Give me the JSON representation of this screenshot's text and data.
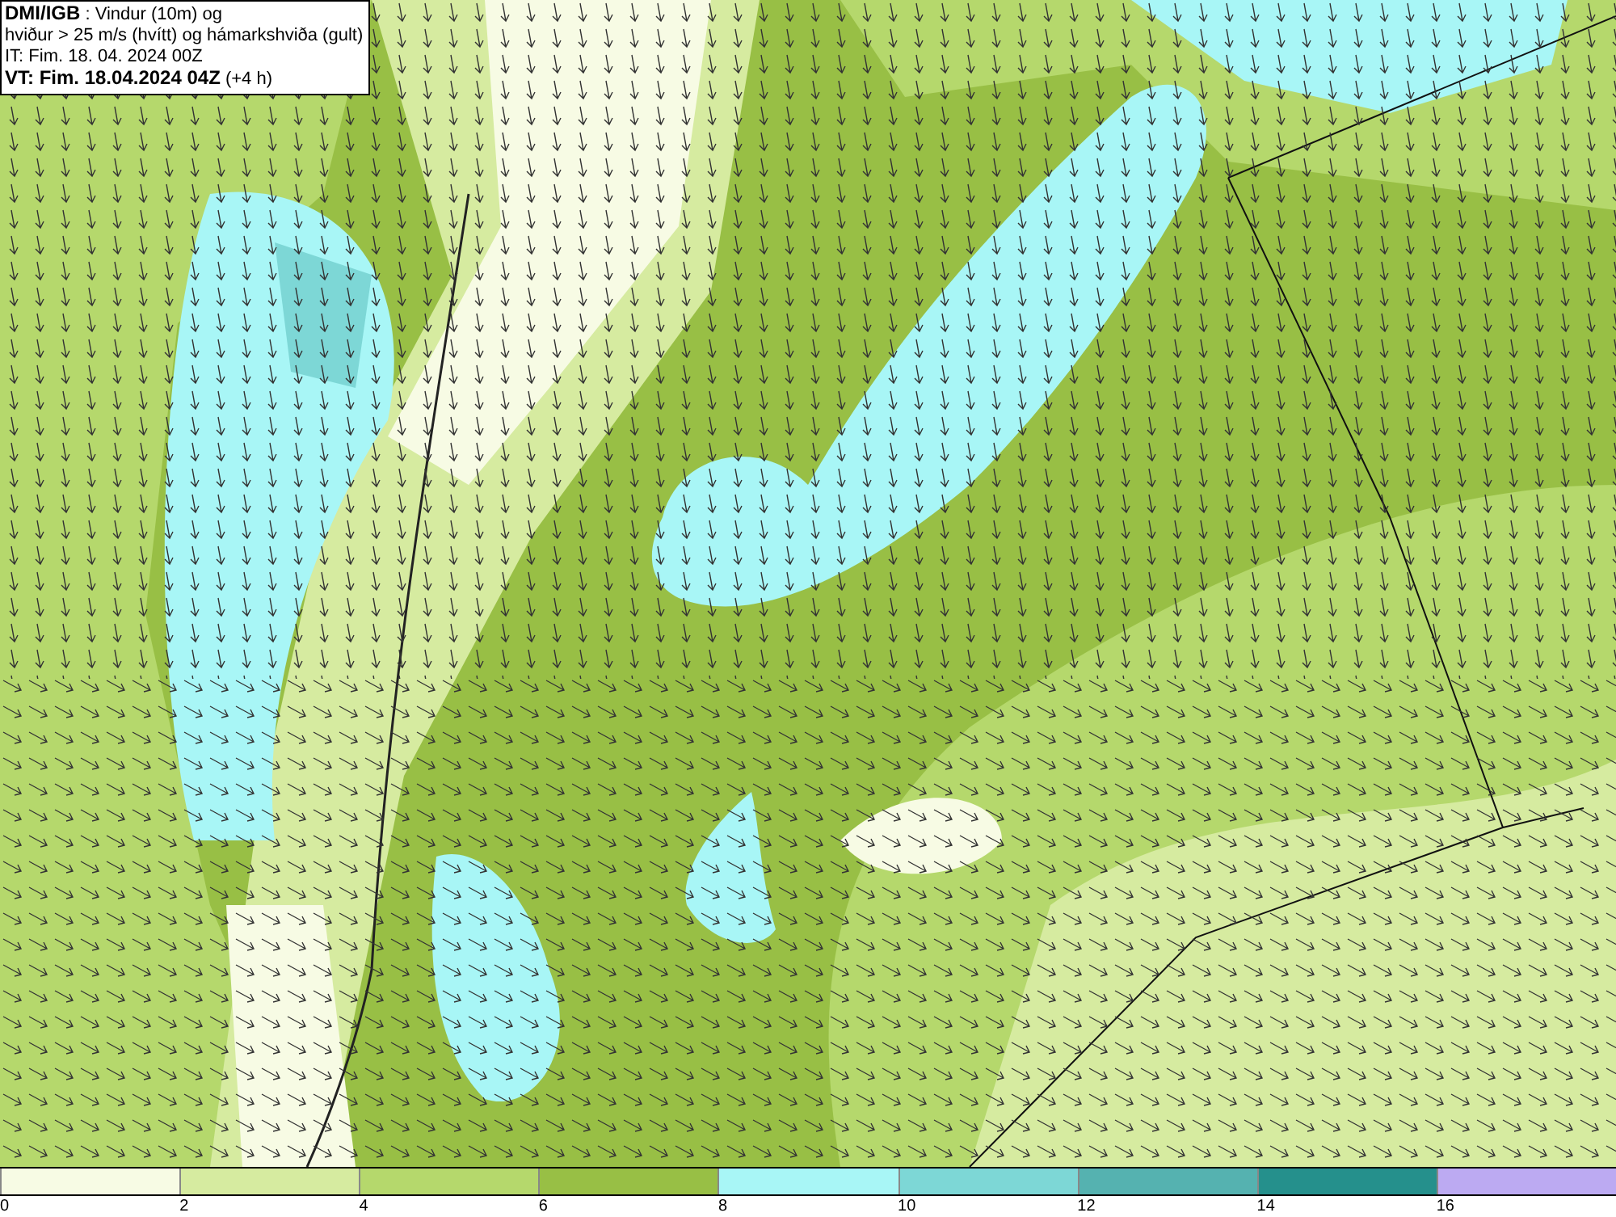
{
  "title_box": {
    "lines": [
      "**DMI/IGB** : Vindur (10m) og",
      "hviður > 25 m/s (hvítt) og hámarkshviða (gult)",
      "IT: Fim. 18. 04. 2024 00Z",
      "**VT: Fim. 18.04.2024 04Z** (+4 h)"
    ]
  },
  "legend": {
    "bins": [
      {
        "tick": "0",
        "color": "#f7fbe4"
      },
      {
        "tick": "2",
        "color": "#d6eba0"
      },
      {
        "tick": "4",
        "color": "#b5d86c"
      },
      {
        "tick": "6",
        "color": "#98bf45"
      },
      {
        "tick": "8",
        "color": "#a8f6f6"
      },
      {
        "tick": "10",
        "color": "#7dd7d6"
      },
      {
        "tick": "12",
        "color": "#55b2b0"
      },
      {
        "tick": "14",
        "color": "#25908c"
      },
      {
        "tick": "16",
        "color": "#bcaaf2"
      }
    ]
  }
}
